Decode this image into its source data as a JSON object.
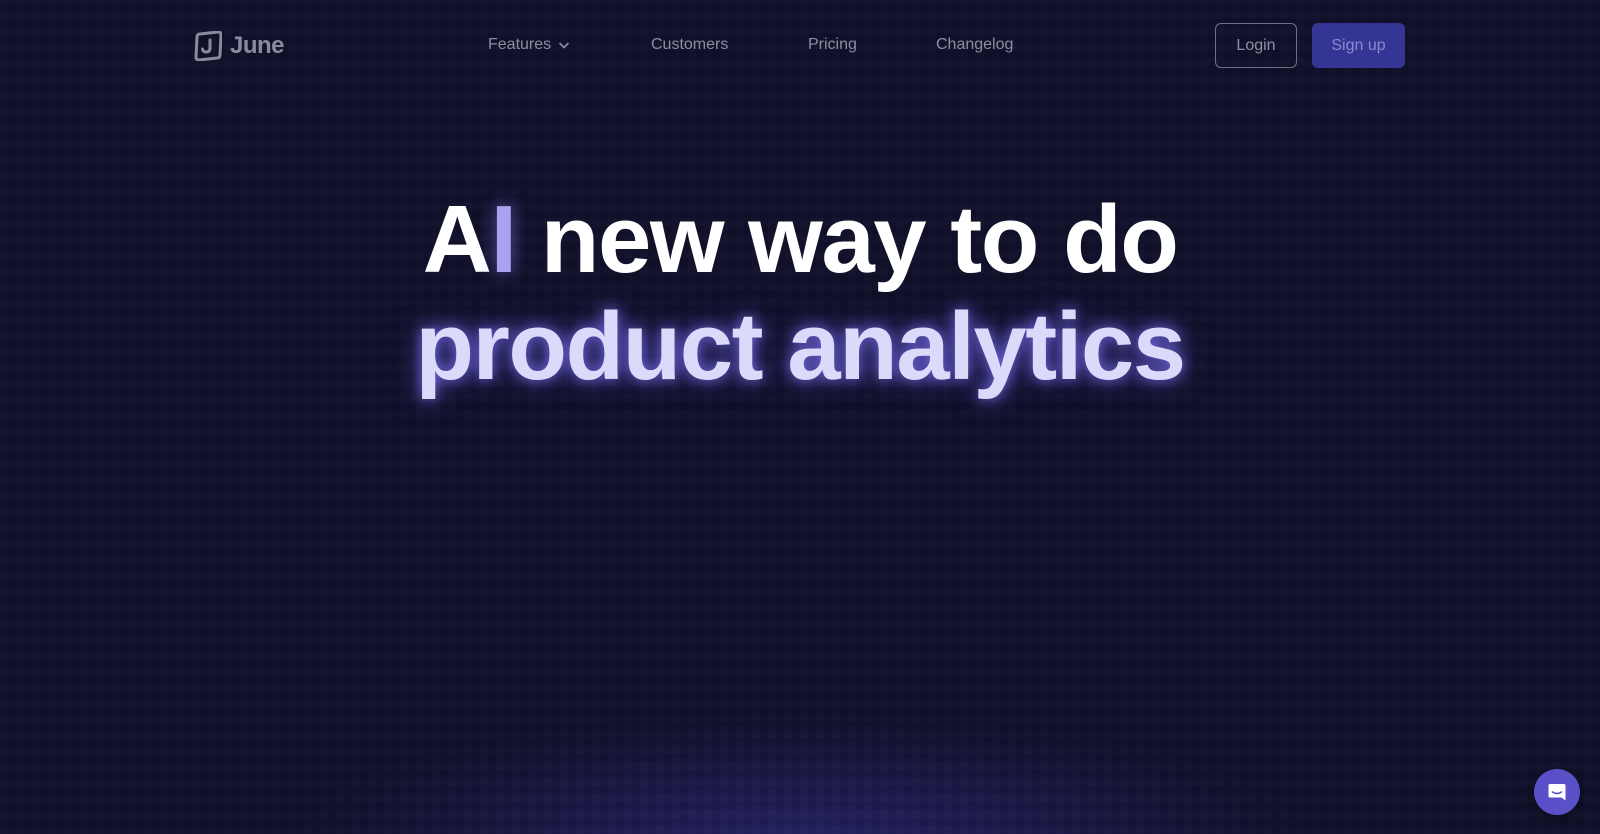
{
  "brand": {
    "name": "June",
    "logo_icon": "june-logo-icon"
  },
  "nav": {
    "items": [
      {
        "label": "Features",
        "has_dropdown": true
      },
      {
        "label": "Customers"
      },
      {
        "label": "Pricing"
      },
      {
        "label": "Changelog"
      }
    ]
  },
  "auth": {
    "login_label": "Login",
    "signup_label": "Sign up"
  },
  "hero": {
    "line1_a": "A",
    "line1_cursor": "I",
    "line1_rest": " new way to do",
    "line2": "product analytics"
  },
  "chat": {
    "icon": "chat-bubble-icon"
  },
  "colors": {
    "background": "#0f0f2a",
    "accent": "#353595",
    "highlight": "#dcdafa",
    "chat_button": "#5a50c8"
  }
}
